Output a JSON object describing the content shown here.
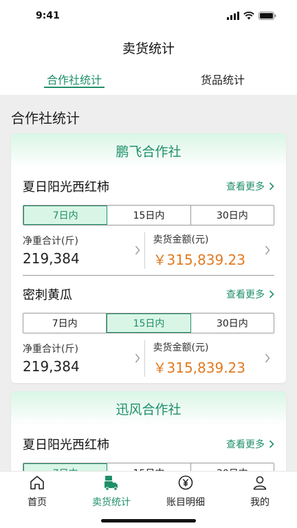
{
  "status": {
    "time": "9:41"
  },
  "header": {
    "title": "卖货统计"
  },
  "tabs": [
    {
      "label": "合作社统计",
      "active": true
    },
    {
      "label": "货品统计",
      "active": false
    }
  ],
  "section": {
    "title": "合作社统计"
  },
  "cooperatives": [
    {
      "name": "鹏飞合作社",
      "products": [
        {
          "name": "夏日阳光西红柿",
          "more": "查看更多",
          "ranges": [
            "7日内",
            "15日内",
            "30日内"
          ],
          "active_range": 0,
          "weight_label": "净重合计(斤)",
          "weight_value": "219,384",
          "amount_label": "卖货金额(元)",
          "amount_value": "￥315,839.23"
        },
        {
          "name": "密刺黄瓜",
          "more": "查看更多",
          "ranges": [
            "7日内",
            "15日内",
            "30日内"
          ],
          "active_range": 1,
          "weight_label": "净重合计(斤)",
          "weight_value": "219,384",
          "amount_label": "卖货金额(元)",
          "amount_value": "￥315,839.23"
        }
      ]
    },
    {
      "name": "迅风合作社",
      "products": [
        {
          "name": "夏日阳光西红柿",
          "more": "查看更多",
          "ranges": [
            "7日内",
            "15日内",
            "30日内"
          ],
          "active_range": 0
        }
      ]
    }
  ],
  "tabbar": [
    {
      "label": "首页",
      "icon": "home-icon",
      "active": false
    },
    {
      "label": "卖货统计",
      "icon": "sales-stats-icon",
      "active": true
    },
    {
      "label": "账目明细",
      "icon": "yen-coin-icon",
      "active": false
    },
    {
      "label": "我的",
      "icon": "user-icon",
      "active": false
    }
  ],
  "colors": {
    "accent": "#1f8f6b",
    "money": "#e07a20",
    "active_bg": "#d9f5e6"
  }
}
